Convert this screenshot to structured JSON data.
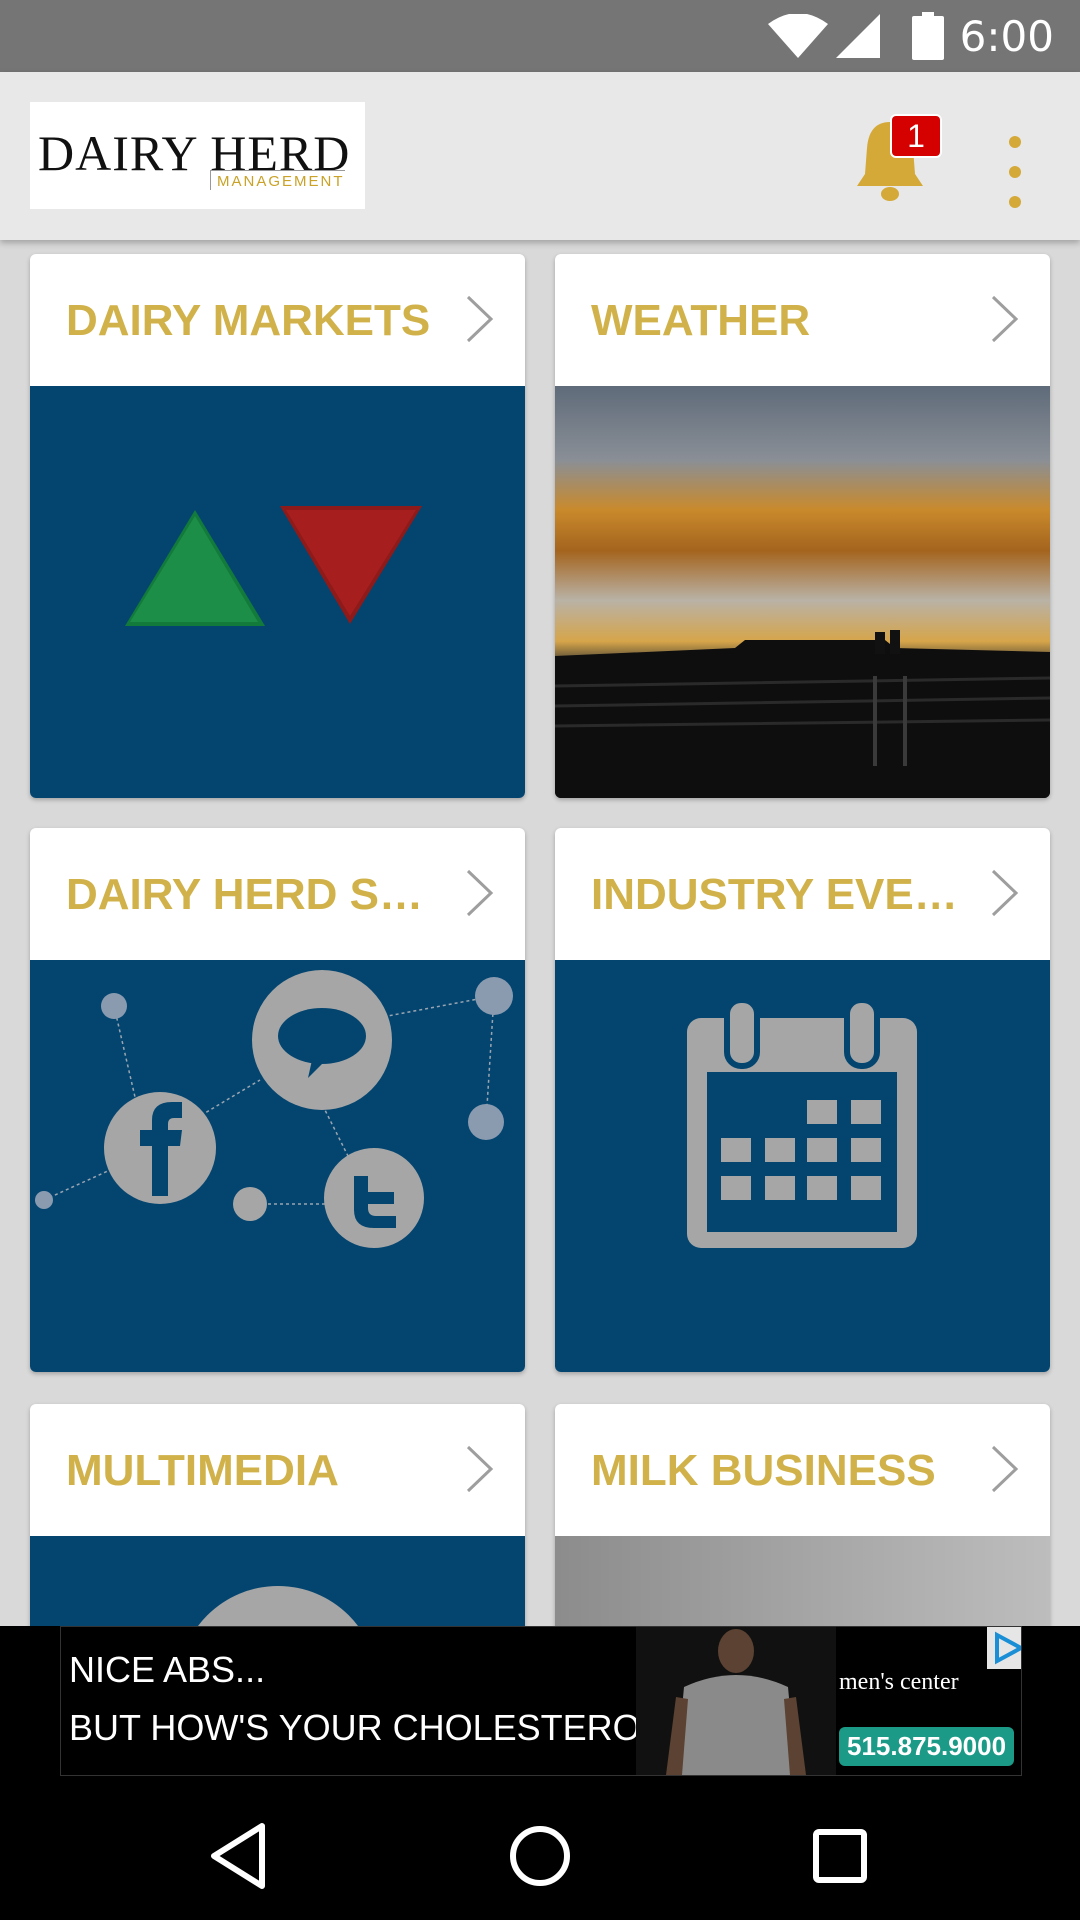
{
  "status_bar": {
    "time": "6:00"
  },
  "app_bar": {
    "logo_main": "DAIRY HERD",
    "logo_sub": "MANAGEMENT",
    "notification_count": "1"
  },
  "cards": [
    {
      "title": "DAIRY MARKETS"
    },
    {
      "title": "WEATHER"
    },
    {
      "title": "DAIRY HERD SO…"
    },
    {
      "title": "INDUSTRY EVEN…"
    },
    {
      "title": "MULTIMEDIA"
    },
    {
      "title": "MILK BUSINESS"
    }
  ],
  "ad": {
    "line1": "NICE ABS...",
    "line2": "BUT HOW'S YOUR CHOLESTEROL?",
    "brand": "men's center",
    "phone": "515.875.9000"
  },
  "colors": {
    "accent": "#d1b24a",
    "tile_bg": "#044570",
    "bell": "#d4a938"
  }
}
